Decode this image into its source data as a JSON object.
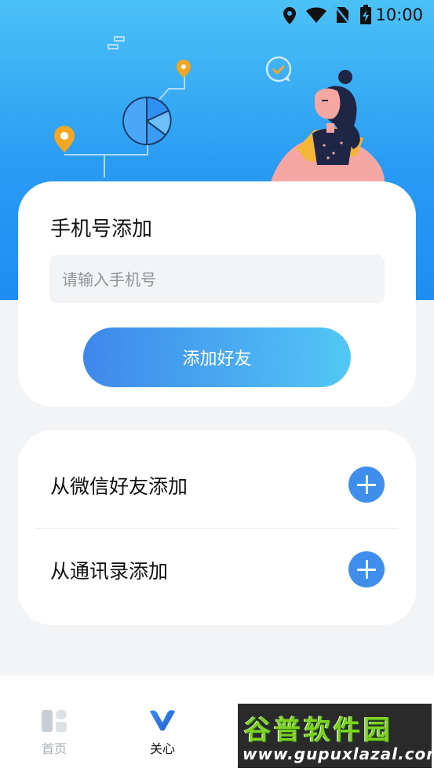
{
  "status_bar": {
    "time": "10:00",
    "icons": [
      "location-icon",
      "wifi-icon",
      "no-sim-icon",
      "battery-charging-icon"
    ]
  },
  "phone_add": {
    "title": "手机号添加",
    "input_placeholder": "请输入手机号",
    "input_value": "",
    "submit_label": "添加好友"
  },
  "other_add": {
    "options": [
      {
        "label": "从微信好友添加",
        "icon": "plus-circle-icon"
      },
      {
        "label": "从通讯录添加",
        "icon": "plus-circle-icon"
      }
    ]
  },
  "tabbar": {
    "tabs": [
      {
        "label": "首页",
        "icon": "home-grid-icon",
        "active": false
      },
      {
        "label": "关心",
        "icon": "v-logo-icon",
        "active": true
      }
    ]
  },
  "watermark": {
    "title": "谷普软件园",
    "url": "www.gupuxlazal.com"
  },
  "colors": {
    "hero_top": "#4cc1f5",
    "hero_bottom": "#1d8df2",
    "button_gradient_start": "#3f87ec",
    "button_gradient_end": "#52c7f5",
    "plus_button": "#3f8eec",
    "active_tab": "#111111",
    "inactive_tab": "#a9afb6"
  }
}
